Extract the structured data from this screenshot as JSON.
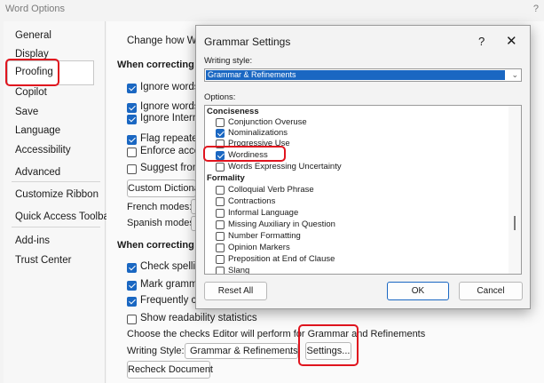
{
  "window": {
    "title": "Word Options",
    "help": "?"
  },
  "sidebar": {
    "items": [
      {
        "label": "General"
      },
      {
        "label": "Display"
      },
      {
        "label": "Proofing"
      },
      {
        "label": "Copilot"
      },
      {
        "label": "Save"
      },
      {
        "label": "Language"
      },
      {
        "label": "Accessibility"
      },
      {
        "label": "Advanced"
      },
      {
        "label": "Customize Ribbon"
      },
      {
        "label": "Quick Access Toolbar"
      },
      {
        "label": "Add-ins"
      },
      {
        "label": "Trust Center"
      }
    ],
    "selected": "Proofing"
  },
  "main": {
    "intro": "Change how Word",
    "section1": "When correcting spe",
    "options1": [
      {
        "label": "Ignore words in",
        "checked": true
      },
      {
        "label": "Ignore words th",
        "checked": true
      },
      {
        "label": "Ignore Internet a",
        "checked": true
      },
      {
        "label": "Flag repeated w",
        "checked": true
      },
      {
        "label": "Enforce accente",
        "checked": false
      },
      {
        "label": "Suggest from m",
        "checked": false
      }
    ],
    "custom_dict_label": "Custom Dictionar",
    "french_modes": "French modes:",
    "spanish_modes": "Spanish modes:",
    "section2": "When correcting spe",
    "options2": [
      {
        "label": "Check spelling a",
        "checked": true
      },
      {
        "label": "Mark grammar",
        "checked": true
      },
      {
        "label": "Frequently confu",
        "checked": true
      },
      {
        "label": "Show readability statistics",
        "checked": false
      }
    ],
    "choose_text": "Choose the checks Editor will perform for Grammar and Refinements",
    "writing_style_label": "Writing Style:",
    "writing_style_value": "Grammar & Refinements",
    "settings_button": "Settings...",
    "recheck_button": "Recheck Document"
  },
  "dialog": {
    "title": "Grammar Settings",
    "help": "?",
    "close": "✕",
    "writing_style_label": "Writing style:",
    "writing_style_value": "Grammar & Refinements",
    "options_label": "Options:",
    "groups": [
      {
        "name": "Conciseness",
        "items": [
          {
            "label": "Conjunction Overuse",
            "checked": false
          },
          {
            "label": "Nominalizations",
            "checked": true
          },
          {
            "label": "Progressive Use",
            "checked": false
          },
          {
            "label": "Wordiness",
            "checked": true
          },
          {
            "label": "Words Expressing Uncertainty",
            "checked": false
          }
        ]
      },
      {
        "name": "Formality",
        "items": [
          {
            "label": "Colloquial Verb Phrase",
            "checked": false
          },
          {
            "label": "Contractions",
            "checked": false
          },
          {
            "label": "Informal Language",
            "checked": false
          },
          {
            "label": "Missing Auxiliary in Question",
            "checked": false
          },
          {
            "label": "Number Formatting",
            "checked": false
          },
          {
            "label": "Opinion Markers",
            "checked": false
          },
          {
            "label": "Preposition at End of Clause",
            "checked": false
          },
          {
            "label": "Slang",
            "checked": false
          }
        ]
      }
    ],
    "reset_button": "Reset All",
    "ok_button": "OK",
    "cancel_button": "Cancel"
  },
  "colors": {
    "accent": "#1a67c2",
    "highlight": "#e0141e"
  }
}
